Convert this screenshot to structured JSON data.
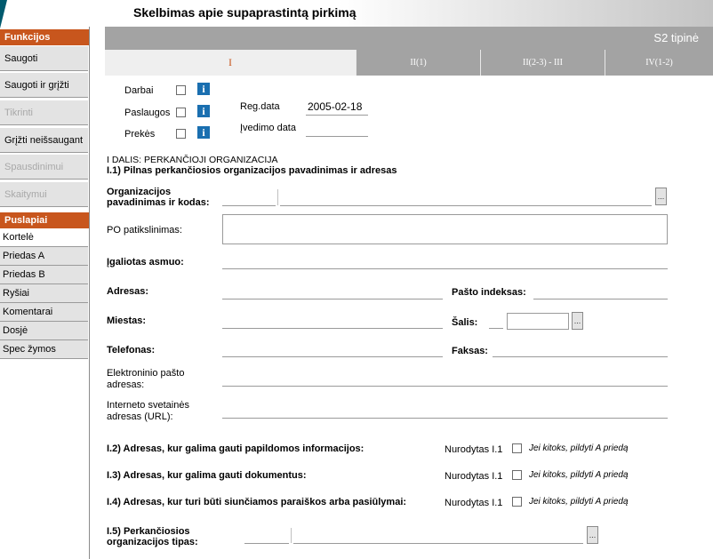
{
  "header": {
    "title": "Skelbimas apie supaprastintą pirkimą",
    "band_label": "S2 tipinė"
  },
  "tabs": [
    {
      "label": "I"
    },
    {
      "label": "II(1)"
    },
    {
      "label": "II(2-3) - III"
    },
    {
      "label": "IV(1-2)"
    }
  ],
  "sidebar": {
    "functions_header": "Funkcijos",
    "functions": [
      {
        "label": "Saugoti",
        "enabled": true
      },
      {
        "label": "Saugoti ir grįžti",
        "enabled": true
      },
      {
        "label": "Tikrinti",
        "enabled": false
      },
      {
        "label": "Grįžti neišsaugant",
        "enabled": true
      },
      {
        "label": "Spausdinimui",
        "enabled": false
      },
      {
        "label": "Skaitymui",
        "enabled": false
      }
    ],
    "pages_header": "Puslapiai",
    "pages": [
      {
        "label": "Kortelė"
      },
      {
        "label": "Priedas A"
      },
      {
        "label": "Priedas B"
      },
      {
        "label": "Ryšiai"
      },
      {
        "label": "Komentarai"
      },
      {
        "label": "Dosjė"
      },
      {
        "label": "Spec žymos"
      }
    ]
  },
  "types": {
    "works": "Darbai",
    "services": "Paslaugos",
    "goods": "Prekės"
  },
  "reg": {
    "label": "Reg.data",
    "value": "2005-02-18",
    "entry_label": "Įvedimo data",
    "entry_value": ""
  },
  "section": {
    "title": "I DALIS: PERKANČIOJI ORGANIZACIJA",
    "s1": "I.1) Pilnas perkančiosios organizacijos pavadinimas ir adresas",
    "org_label_1": "Organizacijos",
    "org_label_2": "pavadinimas ir kodas:",
    "po_label": "PO patikslinimas:",
    "auth_label": "Įgaliotas asmuo:",
    "address_label": "Adresas:",
    "postal_label": "Pašto indeksas:",
    "city_label": "Miestas:",
    "country_label": "Šalis:",
    "phone_label": "Telefonas:",
    "fax_label": "Faksas:",
    "email_label_1": "Elektroninio pašto",
    "email_label_2": "adresas:",
    "web_label_1": "Interneto svetainės",
    "web_label_2": "adresas (URL):",
    "s2": "I.2) Adresas, kur galima gauti papildomos informacijos:",
    "s3": "I.3) Adresas, kur galima gauti dokumentus:",
    "s4": "I.4) Adresas, kur turi būti siunčiamos paraiškos arba pasiūlymai:",
    "specified": "Nurodytas I.1",
    "other_hint": "Jei kitoks, pildyti A priedą",
    "s5_1": "I.5) Perkančiosios",
    "s5_2": "organizacijos tipas:",
    "ellipsis": "..."
  }
}
